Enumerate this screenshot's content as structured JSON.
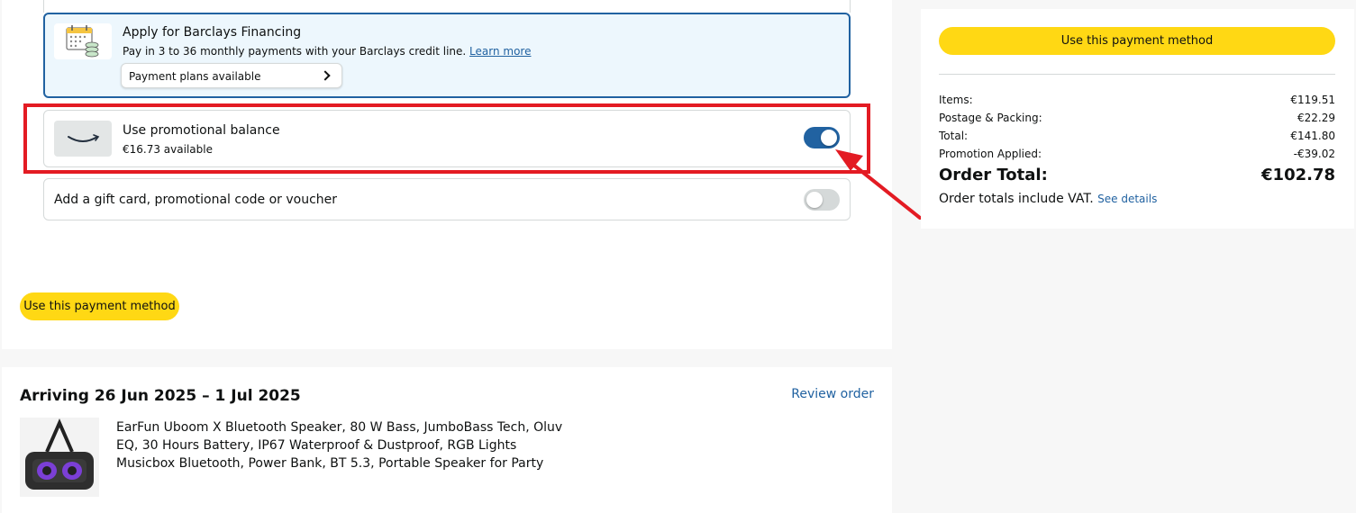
{
  "financing": {
    "title": "Apply for Barclays Financing",
    "subtitle": "Pay in 3 to 36 monthly payments with your Barclays credit line.",
    "learn_more": "Learn more",
    "plans_button": "Payment plans available",
    "icon": "calendar-coins-icon"
  },
  "promo": {
    "title": "Use promotional balance",
    "available": "€16.73 available",
    "toggle_on": true,
    "logo": "amazon-smile-logo"
  },
  "gift": {
    "label": "Add a gift card, promotional code or voucher",
    "toggle_on": false
  },
  "left_button": "Use this payment method",
  "delivery": {
    "title": "Arriving 26 Jun 2025 – 1 Jul 2025",
    "review_link": "Review order",
    "product_title": "EarFun Uboom X Bluetooth Speaker, 80 W Bass, JumboBass Tech, Oluv EQ, 30 Hours Battery, IP67 Waterproof & Dustproof, RGB Lights Musicbox Bluetooth, Power Bank, BT 5.3, Portable Speaker for Party",
    "product_image": "speaker-image"
  },
  "summary": {
    "button": "Use this payment method",
    "rows": [
      {
        "label": "Items:",
        "value": "€119.51"
      },
      {
        "label": "Postage & Packing:",
        "value": "€22.29"
      },
      {
        "label": "Total:",
        "value": "€141.80"
      },
      {
        "label": "Promotion Applied:",
        "value": "-€39.02"
      }
    ],
    "order_total_label": "Order Total:",
    "order_total_value": "€102.78",
    "vat_note": "Order totals include VAT.",
    "see_details": "See details"
  },
  "colors": {
    "accent_blue": "#2162a1",
    "button_yellow": "#ffd814",
    "annotation_red": "#e31b23"
  }
}
